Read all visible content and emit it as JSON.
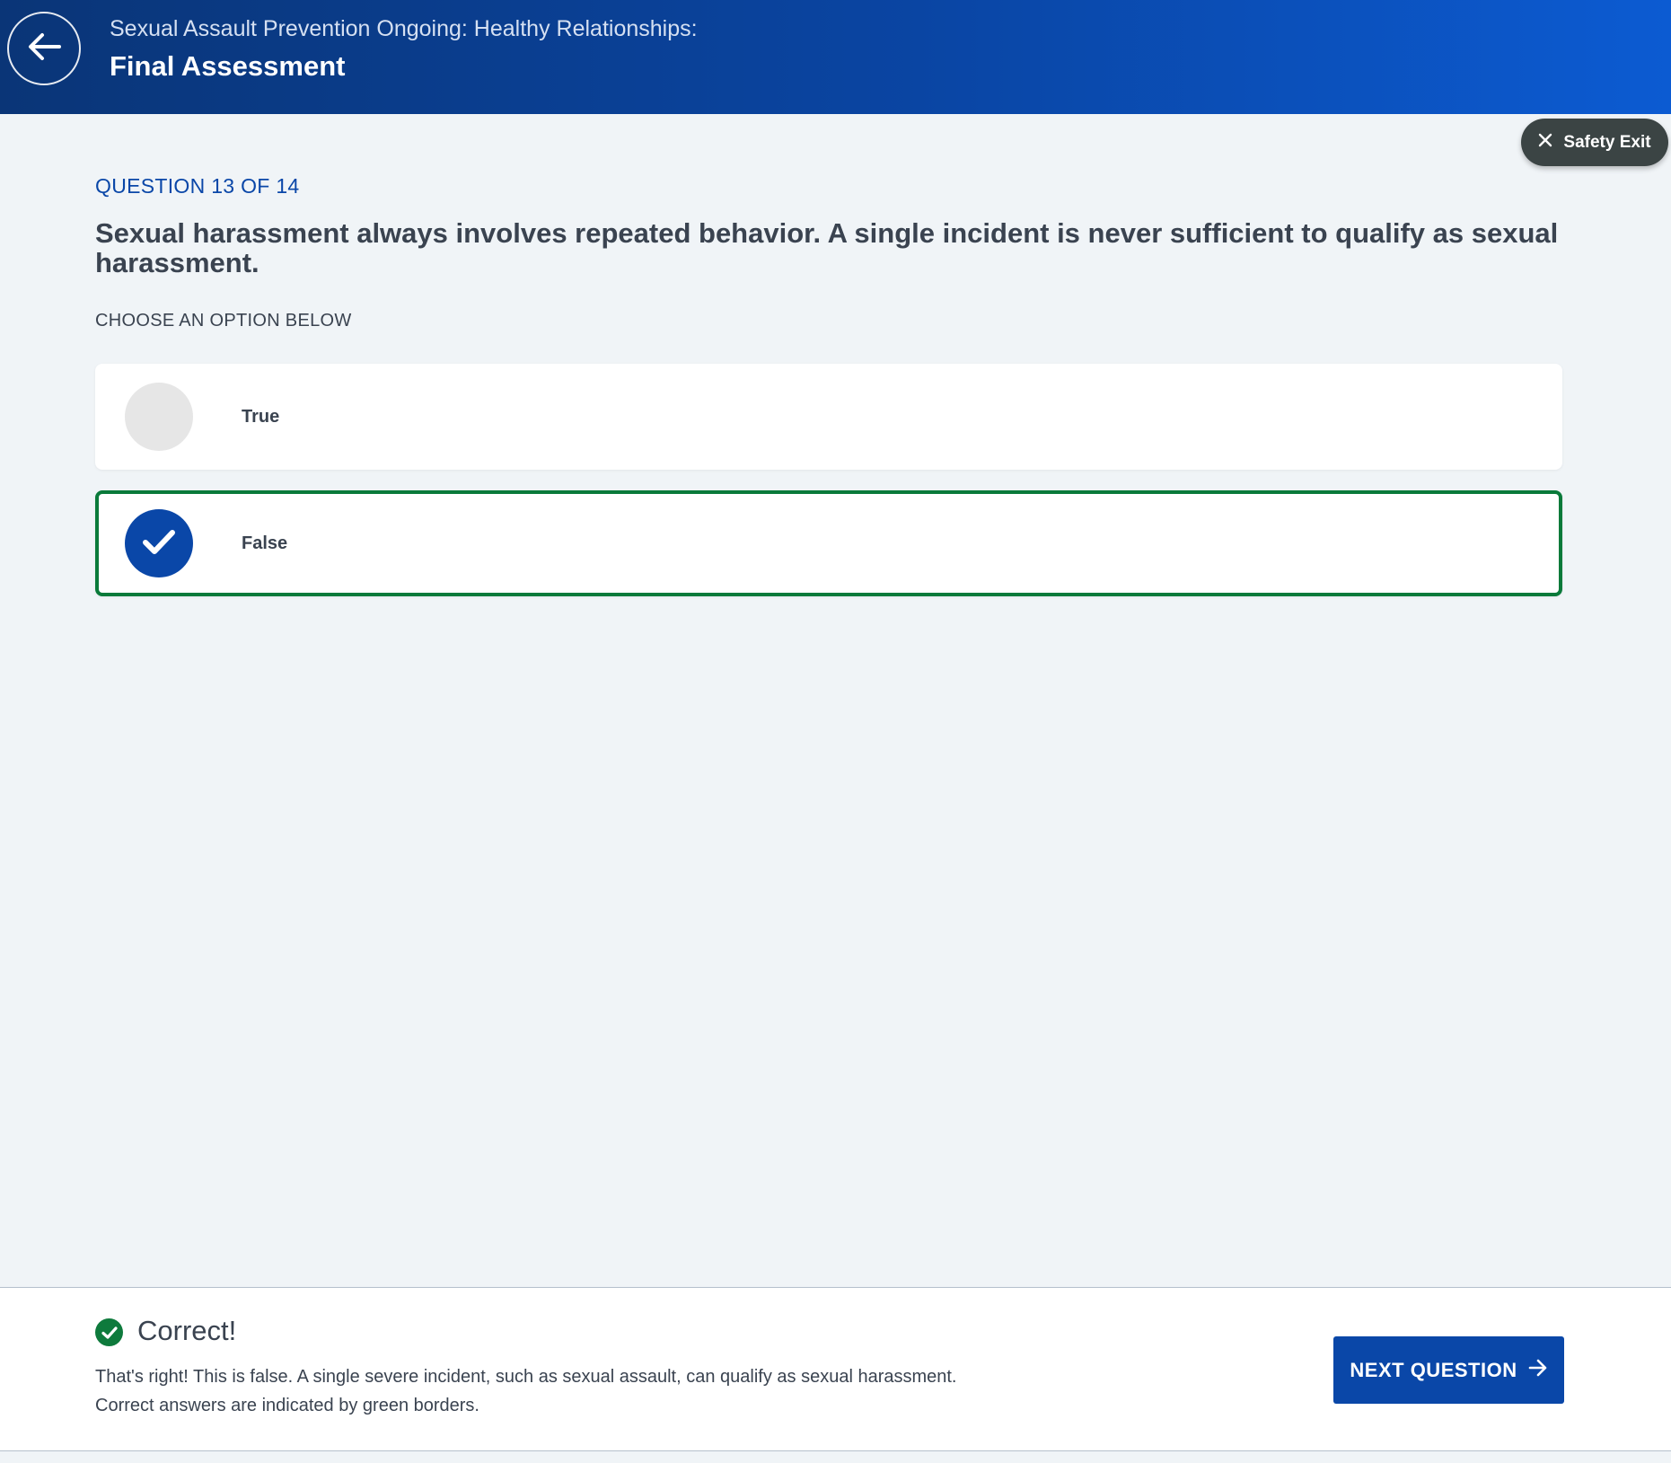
{
  "header": {
    "back_icon": "arrow-left-icon",
    "course_title": "Sexual Assault Prevention Ongoing: Healthy Relationships:",
    "page_title": "Final Assessment"
  },
  "safety_exit": {
    "icon": "close-icon",
    "label": "Safety Exit"
  },
  "question": {
    "counter": "QUESTION 13 OF 14",
    "text": "Sexual harassment always involves repeated behavior. A single incident is never sufficient to qualify as sexual harassment.",
    "instruction": "CHOOSE AN OPTION BELOW",
    "options": [
      {
        "label": "True",
        "selected": false,
        "correct": false
      },
      {
        "label": "False",
        "selected": true,
        "correct": true,
        "icon": "checkmark-icon"
      }
    ]
  },
  "feedback": {
    "icon": "check-circle-icon",
    "title": "Correct!",
    "message": "That's right! This is false. A single severe incident, such as sexual assault, can qualify as sexual harassment.",
    "note": "Correct answers are indicated by green borders."
  },
  "next_button": {
    "label": "NEXT QUESTION",
    "icon": "arrow-right-icon"
  },
  "colors": {
    "header_start": "#0a3577",
    "header_end": "#0c5bd2",
    "primary": "#0a47a8",
    "correct_green": "#0a7a3a",
    "background": "#f0f4f7"
  }
}
